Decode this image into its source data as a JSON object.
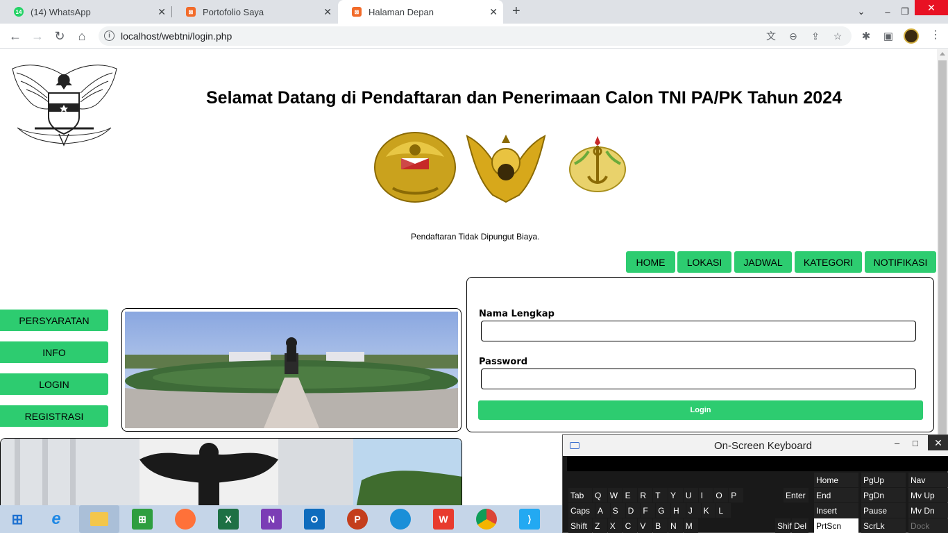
{
  "tabs": [
    {
      "title": "(14) WhatsApp",
      "badge": "14",
      "color": "#25d366",
      "active": false
    },
    {
      "title": "Portofolio Saya",
      "color": "#f26b2a",
      "active": false
    },
    {
      "title": "Halaman Depan",
      "color": "#f26b2a",
      "active": true
    }
  ],
  "toolbar": {
    "url": "localhost/webtni/login.php"
  },
  "page": {
    "headline": "Selamat Datang di Pendaftaran dan Penerimaan Calon TNI PA/PK Tahun 2024",
    "notice": "Pendaftaran Tidak Dipungut Biaya.",
    "top_nav": [
      "HOME",
      "LOKASI",
      "JADWAL",
      "KATEGORI",
      "NOTIFIKASI"
    ],
    "side_nav": [
      "PERSYARATAN",
      "INFO",
      "LOGIN",
      "REGISTRASI"
    ],
    "form": {
      "name_label": "Nama Lengkap",
      "name_value": "",
      "password_label": "Password",
      "password_value": "",
      "submit_label": "Login"
    },
    "accent_color": "#2dcc70"
  },
  "osk": {
    "title": "On-Screen Keyboard",
    "rows": [
      [
        "Tab",
        "Q",
        "W",
        "E",
        "R",
        "T",
        "Y",
        "U",
        "I",
        "O",
        "P"
      ],
      [
        "Caps",
        "A",
        "S",
        "D",
        "F",
        "G",
        "H",
        "J",
        "K",
        "L"
      ],
      [
        "Shift",
        "Z",
        "X",
        "C",
        "V",
        "B",
        "N",
        "M"
      ]
    ],
    "enter": "Enter",
    "shift_right": "Shift",
    "del": "Del",
    "nav_keys": [
      [
        "Home",
        "PgUp",
        "Nav"
      ],
      [
        "End",
        "PgDn",
        "Mv Up"
      ],
      [
        "Insert",
        "Pause",
        "Mv Dn"
      ],
      [
        "PrtScn",
        "ScrLk",
        "Dock"
      ]
    ]
  },
  "taskbar": {
    "apps": [
      "start",
      "internet-explorer",
      "file-explorer",
      "microsoft-store",
      "firefox",
      "excel",
      "onenote",
      "outlook",
      "powerpoint",
      "edge",
      "wps-office",
      "chrome",
      "visual-studio-code"
    ]
  }
}
